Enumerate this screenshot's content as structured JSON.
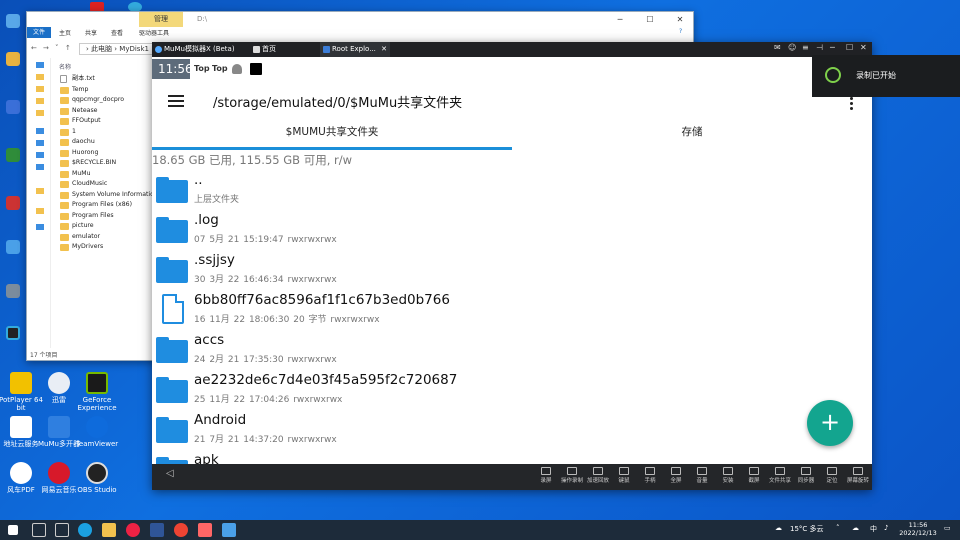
{
  "explorer": {
    "context_tab": "管理",
    "title": "D:\\",
    "ribbon": {
      "file": "文件",
      "home": "主页",
      "share": "共享",
      "view": "查看",
      "drive_tools": "驱动器工具"
    },
    "address": "› 此电脑 › MyDisk1",
    "column_header": "名称",
    "items": [
      "副本.txt",
      "Temp",
      "qqpcmgr_docpro",
      "Netease",
      "FFOutput",
      "1",
      "daochu",
      "Huorong",
      "$RECYCLE.BIN",
      "MuMu",
      "CloudMusic",
      "System Volume Information",
      "Program Files (x86)",
      "Program Files",
      "picture",
      "emulator",
      "MyDrivers"
    ],
    "status": "17 个项目"
  },
  "emulator": {
    "title_tab": "MuMu模拟器X (Beta)",
    "home_tab": "首页",
    "app_tab": "Root Explo...",
    "status": {
      "time": "11:56",
      "s1": "Top",
      "s2": "Top"
    },
    "path": "/storage/emulated/0/$MuMu共享文件夹",
    "tabs": [
      "$MUMU共享文件夹",
      "存储"
    ],
    "storage_info": "18.65 GB 已用, 115.55 GB 可用, r/w",
    "rows": [
      {
        "name": "..",
        "meta": "上层文件夹",
        "type": "folder"
      },
      {
        "name": ".log",
        "meta": "07 5月 21 15:19:47   rwxrwxrwx",
        "type": "folder"
      },
      {
        "name": ".ssjjsy",
        "meta": "30 3月 22 16:46:34   rwxrwxrwx",
        "type": "folder"
      },
      {
        "name": "6bb80ff76ac8596af1f1c67b3ed0b766",
        "meta": "16 11月 22 18:06:30  20 字节  rwxrwxrwx",
        "type": "file"
      },
      {
        "name": "accs",
        "meta": "24 2月 21 17:35:30   rwxrwxrwx",
        "type": "folder"
      },
      {
        "name": "ae2232de6c7d4e03f45a595f2c720687",
        "meta": "25 11月 22 17:04:26   rwxrwxrwx",
        "type": "folder"
      },
      {
        "name": "Android",
        "meta": "21 7月 21 14:37:20   rwxrwxrwx",
        "type": "folder"
      },
      {
        "name": "apk",
        "meta": "",
        "type": "folder"
      }
    ],
    "fab": "+",
    "toolbar": [
      "录屏",
      "操作录制",
      "加速回放",
      "键鼠",
      "手柄",
      "全屏",
      "音量",
      "安装",
      "截屏",
      "文件共享",
      "同步器",
      "定位",
      "屏幕旋转"
    ]
  },
  "toast": "录制已开始",
  "desktop_icons": [
    "PotPlayer 64 bit",
    "迅雷",
    "GeForce Experience",
    "地址云服务",
    "MuMu多开器",
    "TeamViewer",
    "风车PDF",
    "网易云音乐",
    "OBS Studio"
  ],
  "taskbar": {
    "weather": "15°C 多云",
    "ime": "中",
    "time": "11:56",
    "date": "2022/12/13"
  },
  "colors": {
    "accent": "#1b8fd9",
    "folder": "#1f8de0",
    "fab": "#13a58f",
    "toast_ring": "#7fd04b"
  }
}
